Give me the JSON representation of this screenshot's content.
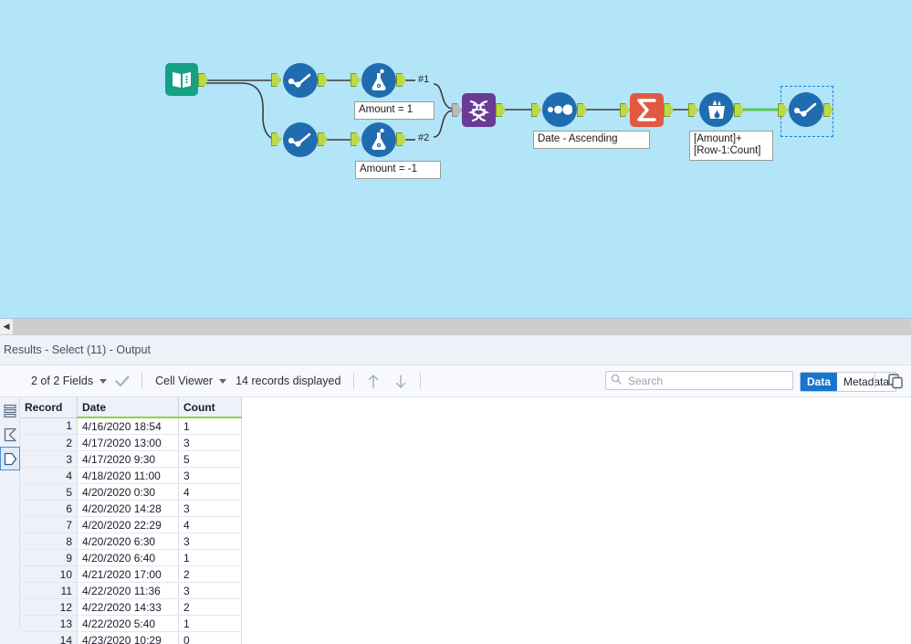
{
  "canvas": {
    "background_color": "#b2e5f7",
    "tools": [
      {
        "id": "input-data",
        "name": "Input Data",
        "icon": "book-icon",
        "color": "#16a085"
      },
      {
        "id": "select-top",
        "name": "Select",
        "icon": "select-checkmark-icon",
        "color": "#1f6cb0"
      },
      {
        "id": "formula-top",
        "name": "Formula",
        "icon": "flask-icon",
        "color": "#1f6cb0"
      },
      {
        "id": "select-bottom",
        "name": "Select",
        "icon": "select-checkmark-icon",
        "color": "#1f6cb0"
      },
      {
        "id": "formula-bottom",
        "name": "Formula",
        "icon": "flask-icon",
        "color": "#1f6cb0"
      },
      {
        "id": "union",
        "name": "Union",
        "icon": "union-dna-icon",
        "color": "#693a96"
      },
      {
        "id": "sort",
        "name": "Sort",
        "icon": "sort-dots-icon",
        "color": "#1f6cb0"
      },
      {
        "id": "summarize",
        "name": "Summarize",
        "icon": "sigma-icon",
        "color": "#e2593f"
      },
      {
        "id": "multi-row-formula",
        "name": "Multi-Row Formula",
        "icon": "bucket-droplets-icon",
        "color": "#1f6cb0"
      },
      {
        "id": "select-output",
        "name": "Select",
        "icon": "select-checkmark-icon",
        "color": "#1f6cb0"
      }
    ],
    "annotations": {
      "formula_top": "Amount = 1",
      "formula_bottom": "Amount = -1",
      "sort": "Date - Ascending",
      "multi_row_formula": "[Amount]+[Row-1:Count]"
    },
    "connection_labels": {
      "input_1": "#1",
      "input_2": "#2"
    },
    "selected_tool": "select-output",
    "highlight_connection_color": "#5ac85a",
    "anchor_color": "#bcd94a"
  },
  "results": {
    "title": "Results - Select (11) - Output",
    "toolbar": {
      "fields_label": "2 of 2 Fields",
      "check_icon": "checkmark-icon",
      "cell_viewer_label": "Cell Viewer",
      "records_label": "14 records displayed",
      "nav_up_icon": "arrow-up-icon",
      "nav_down_icon": "arrow-down-icon",
      "search_placeholder": "Search",
      "search_value": "",
      "search_icon": "search-icon",
      "data_tab": "Data",
      "metadata_tab": "Metadata",
      "active_tab": "Data",
      "copy_icon": "copy-icon",
      "accent_color": "#1675d1"
    },
    "rail": [
      {
        "id": "rail-table",
        "icon": "table-rows-icon"
      },
      {
        "id": "rail-all",
        "icon": "all-anchor-icon"
      },
      {
        "id": "rail-output",
        "icon": "output-anchor-icon",
        "selected": true
      }
    ],
    "table": {
      "columns": [
        "Record",
        "Date",
        "Count"
      ],
      "rows": [
        {
          "record": "1",
          "date": "4/16/2020 18:54",
          "count": "1"
        },
        {
          "record": "2",
          "date": "4/17/2020 13:00",
          "count": "3"
        },
        {
          "record": "3",
          "date": "4/17/2020 9:30",
          "count": "5"
        },
        {
          "record": "4",
          "date": "4/18/2020 11:00",
          "count": "3"
        },
        {
          "record": "5",
          "date": "4/20/2020 0:30",
          "count": "4"
        },
        {
          "record": "6",
          "date": "4/20/2020 14:28",
          "count": "3"
        },
        {
          "record": "7",
          "date": "4/20/2020 22:29",
          "count": "4"
        },
        {
          "record": "8",
          "date": "4/20/2020 6:30",
          "count": "3"
        },
        {
          "record": "9",
          "date": "4/20/2020 6:40",
          "count": "1"
        },
        {
          "record": "10",
          "date": "4/21/2020 17:00",
          "count": "2"
        },
        {
          "record": "11",
          "date": "4/22/2020 11:36",
          "count": "3"
        },
        {
          "record": "12",
          "date": "4/22/2020 14:33",
          "count": "2"
        },
        {
          "record": "13",
          "date": "4/22/2020 5:40",
          "count": "1"
        },
        {
          "record": "14",
          "date": "4/23/2020 10:29",
          "count": "0"
        }
      ]
    }
  },
  "scrollbar": {
    "left_arrow_icon": "chevron-left-icon"
  }
}
